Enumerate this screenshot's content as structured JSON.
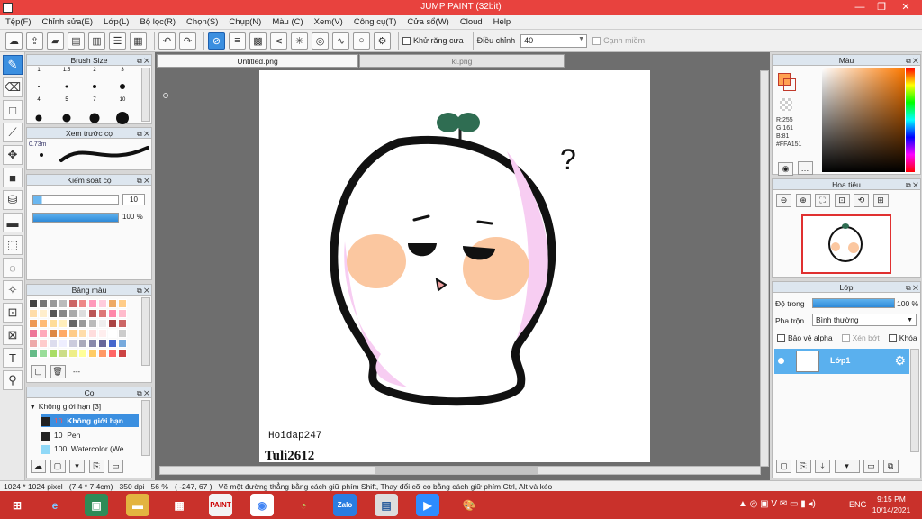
{
  "window": {
    "title": "JUMP PAINT (32bit)"
  },
  "menu": [
    "Tệp(F)",
    "Chỉnh sửa(E)",
    "Lớp(L)",
    "Bộ lọc(R)",
    "Chọn(S)",
    "Chụp(N)",
    "Màu (C)",
    "Xem(V)",
    "Công cụ(T)",
    "Cửa sổ(W)",
    "Cloud",
    "Help"
  ],
  "toolbar": {
    "antialias_label": "Khử răng cưa",
    "adjust_label": "Điều chỉnh",
    "adjust_value": "40",
    "edge_label": "Cạnh miềm"
  },
  "brush_size": {
    "title": "Brush Size",
    "labels": [
      "1",
      "1.5",
      "2",
      "3",
      "4",
      "5",
      "7",
      "10"
    ]
  },
  "preview": {
    "title": "Xem trước cọ",
    "size": "0.73m"
  },
  "brush_control": {
    "title": "Kiểm soát cọ",
    "size_value": "10",
    "opacity_value": "100 %"
  },
  "palette": {
    "title": "Bảng màu",
    "extra": "---"
  },
  "brush_list": {
    "title": "Cọ",
    "group": "Không giới hạn [3]",
    "items": [
      {
        "size": "10",
        "name": "Không giới hạn"
      },
      {
        "size": "10",
        "name": "Pen"
      },
      {
        "size": "100",
        "name": "Watercolor (We"
      }
    ]
  },
  "tabs": {
    "doc1": "Untitled.png",
    "doc2": "ki.png"
  },
  "canvas": {
    "question_mark": "?",
    "watermark1": "Hoidap247",
    "watermark2": "Tuli2612"
  },
  "color_panel": {
    "title": "Màu",
    "r": "R:255",
    "g": "G:161",
    "b": "B:81",
    "hex": "#FFA151",
    "fg_color": "#FFA151"
  },
  "navigator": {
    "title": "Hoa tiêu"
  },
  "layer_panel": {
    "title": "Lớp",
    "opacity_label": "Độ trong",
    "opacity_value": "100 %",
    "blend_label": "Pha trộn",
    "blend_value": "Bình thường",
    "protect_alpha": "Bảo vệ alpha",
    "clip": "Xén bớt",
    "lock": "Khóa",
    "layer_name": "Lớp1"
  },
  "status": {
    "size": "1024 * 1024 pixel",
    "cm": "(7.4 * 7.4cm)",
    "dpi": "350 dpi",
    "zoom": "56 %",
    "coords": "( -247, 67 )",
    "hint": "Vẽ một đường thẳng bằng cách giữ phím Shift, Thay đổi cỡ cọ bằng cách giữ phím Ctrl, Alt và kéo"
  },
  "taskbar": {
    "lang": "ENG",
    "time": "9:15 PM",
    "date": "10/14/2021"
  }
}
